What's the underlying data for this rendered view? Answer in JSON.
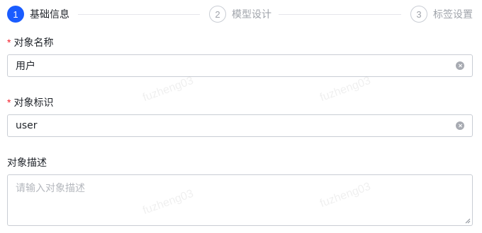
{
  "steps": [
    {
      "number": "1",
      "label": "基础信息",
      "state": "active"
    },
    {
      "number": "2",
      "label": "模型设计",
      "state": "inactive"
    },
    {
      "number": "3",
      "label": "标签设置",
      "state": "inactive"
    }
  ],
  "form": {
    "name": {
      "required_mark": "*",
      "label": "对象名称",
      "value": "用户"
    },
    "identifier": {
      "required_mark": "*",
      "label": "对象标识",
      "value": "user"
    },
    "description": {
      "label": "对象描述",
      "placeholder": "请输入对象描述",
      "value": ""
    }
  },
  "watermark": "fuzheng03",
  "colors": {
    "accent": "#1a5cff",
    "required": "#f5222d",
    "border": "#c9cdd4"
  }
}
